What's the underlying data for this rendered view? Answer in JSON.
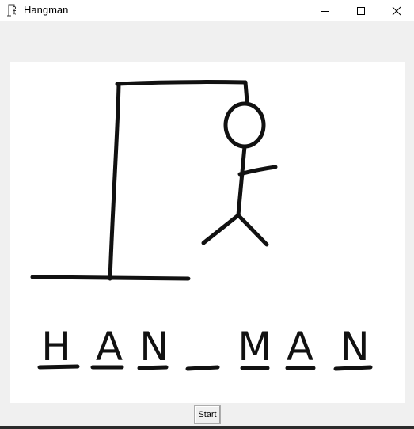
{
  "window": {
    "title": "Hangman"
  },
  "game": {
    "word_letters": [
      "H",
      "A",
      "N",
      "",
      "M",
      "A",
      "N"
    ],
    "start_label": "Start"
  },
  "icons": {
    "app": "hangman-app-icon",
    "minimize": "minimize-icon",
    "maximize": "maximize-icon",
    "close": "close-icon"
  }
}
